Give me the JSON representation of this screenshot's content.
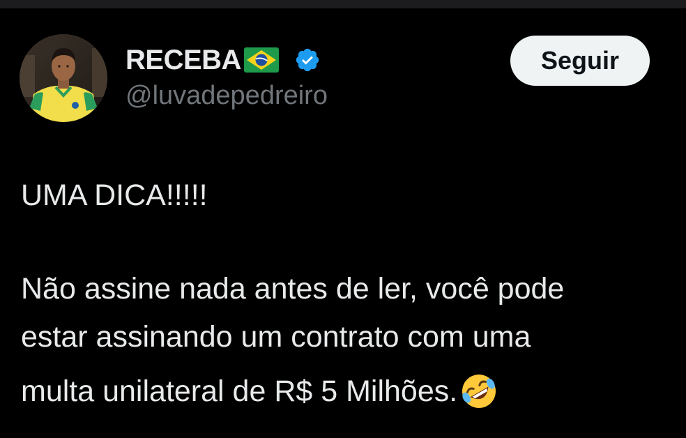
{
  "tweet": {
    "author": {
      "display_name": "RECEBA",
      "handle": "@luvadepedreiro",
      "flag_icon": "brazil-flag-icon",
      "verified_icon": "verified-badge-icon",
      "verified_color": "#1d9bf0"
    },
    "follow_button_label": "Seguir",
    "text_lines": [
      "UMA DICA!!!!!",
      "Não assine nada antes de ler, você pode",
      "estar assinando um contrato com uma",
      "multa unilateral de R$ 5 Milhões."
    ],
    "trailing_emoji": "rolling-on-floor-laughing-icon"
  },
  "colors": {
    "background": "#000000",
    "text_primary": "#e7e9ea",
    "text_secondary": "#71767b",
    "button_bg": "#eff3f4",
    "button_text": "#0f1419"
  }
}
